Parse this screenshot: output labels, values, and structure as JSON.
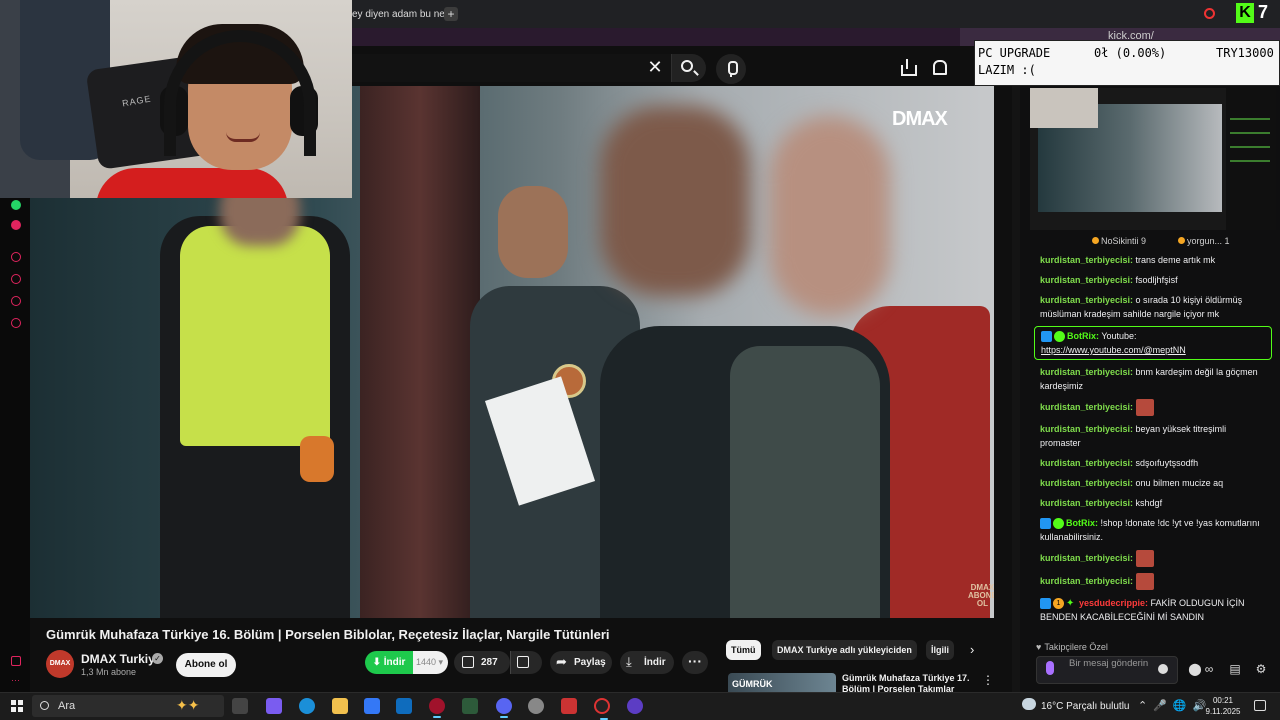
{
  "browser": {
    "tab_title": "ey diyen adam bu ney",
    "new_tab": "+",
    "address_kick": "kick.com/"
  },
  "header": {
    "clear_glyph": "✕"
  },
  "video": {
    "logo": "DMAX",
    "logo_small": "DMAX ABONE OL",
    "title": "Gümrük Muhafaza Türkiye 16. Bölüm | Porselen Biblolar, Reçetesiz İlaçlar, Nargile Tütünleri"
  },
  "channel": {
    "avatar_text": "DMAX",
    "name": "DMAX Turkiye",
    "subscribers": "1,3 Mn abone",
    "subscribe_label": "Abone ol"
  },
  "actions": {
    "download_green": "⬇ İndir",
    "download_count": "1440 ▾",
    "likes": "287",
    "share": "Paylaş",
    "download": "İndir",
    "more": "···"
  },
  "chips": [
    "Tümü",
    "DMAX Turkiye adlı yükleyiciden",
    "İlgili"
  ],
  "chips_next": "›",
  "recommended": {
    "thumb_text": "GÜMRÜK",
    "title": "Gümrük Muhafaza Türkiye 17. Bölüm | Porselen Takımlar",
    "more": "⋮"
  },
  "ticker": {
    "line1_a": "PC UPGRADE",
    "line1_b": "0ł (0.00%)",
    "line1_c": "TRY13000",
    "line2": "LAZIM :("
  },
  "preview_bar": {
    "item1": "NoSikintii 9",
    "item2": "yorgun... 1"
  },
  "chat": {
    "messages": [
      {
        "user": "kurdistan_terbiyecisi:",
        "text": " trans deme artık mk"
      },
      {
        "user": "kurdistan_terbiyecisi:",
        "text": " fsodljhfşisf"
      },
      {
        "user": "kurdistan_terbiyecisi:",
        "text": " o sırada 10 kişiyi öldürmüş müslüman kradeşim sahilde nargile içiyor mk"
      },
      {
        "user": "BotRix:",
        "text": " Youtube:",
        "link": "https://www.youtube.com/@meptNN"
      },
      {
        "user": "kurdistan_terbiyecisi:",
        "text": " bnm kardeşim değil la göçmen kardeşimiz"
      },
      {
        "user": "kurdistan_terbiyecisi:",
        "text": ""
      },
      {
        "user": "kurdistan_terbiyecisi:",
        "text": " beyan yüksek titreşimli promaster"
      },
      {
        "user": "kurdistan_terbiyecisi:",
        "text": " sdşoıfuytşsodfh"
      },
      {
        "user": "kurdistan_terbiyecisi:",
        "text": " onu bilmen mucize aq"
      },
      {
        "user": "kurdistan_terbiyecisi:",
        "text": " kshdgf"
      },
      {
        "user": "BotRix:",
        "text": " !shop !donate !dc !yt ve !yas komutlarını kullanabilirsiniz."
      },
      {
        "user": "kurdistan_terbiyecisi:",
        "text": ""
      },
      {
        "user": "kurdistan_terbiyecisi:",
        "text": ""
      },
      {
        "user": "yesdudecrippie:",
        "text": " FAKİR OLDUGUN İÇİN BENDEN KACABİLECEĞİNİ Mİ SANDIN"
      }
    ],
    "followers_only": "Takipçilere Özel",
    "placeholder": "Bir mesaj gönderin"
  },
  "taskbar": {
    "search": "Ara",
    "weather": "16°C  Parçalı bulutlu",
    "time": "00:21",
    "date": "9.11.2025"
  },
  "colors": {
    "kick_green": "#53fc18",
    "youtube_bg": "#0f0f0f",
    "download_green": "#1ec94c"
  }
}
